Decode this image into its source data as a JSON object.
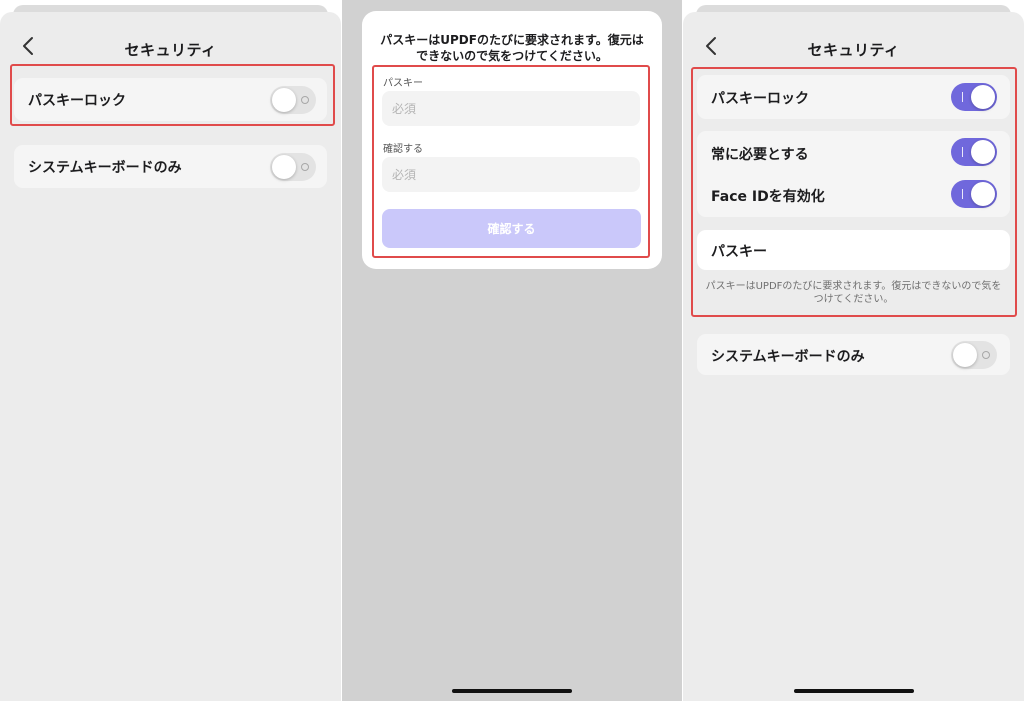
{
  "colors": {
    "accent": "#7068dc",
    "highlight": "#e04b4b",
    "confirm_disabled": "#cac8fa"
  },
  "left": {
    "title": "セキュリティ",
    "back_icon": "chevron-left-icon",
    "rows": [
      {
        "label": "パスキーロック",
        "toggle": "off"
      },
      {
        "label": "システムキーボードのみ",
        "toggle": "off"
      }
    ]
  },
  "middle": {
    "message": "パスキーはUPDFのたびに要求されます。復元はできないので気をつけてください。",
    "passkey_label": "パスキー",
    "passkey_placeholder": "必須",
    "confirm_label": "確認する",
    "confirm_placeholder": "必須",
    "confirm_button": "確認する"
  },
  "right": {
    "title": "セキュリティ",
    "back_icon": "chevron-left-icon",
    "passkey_lock_label": "パスキーロック",
    "passkey_lock_toggle": "on",
    "always_required_label": "常に必要とする",
    "always_required_toggle": "on",
    "face_id_label": "Face IDを有効化",
    "face_id_toggle": "on",
    "passkey_item": "パスキー",
    "note": "パスキーはUPDFのたびに要求されます。復元はできないので気をつけてください。",
    "system_keyboard_label": "システムキーボードのみ",
    "system_keyboard_toggle": "off"
  }
}
